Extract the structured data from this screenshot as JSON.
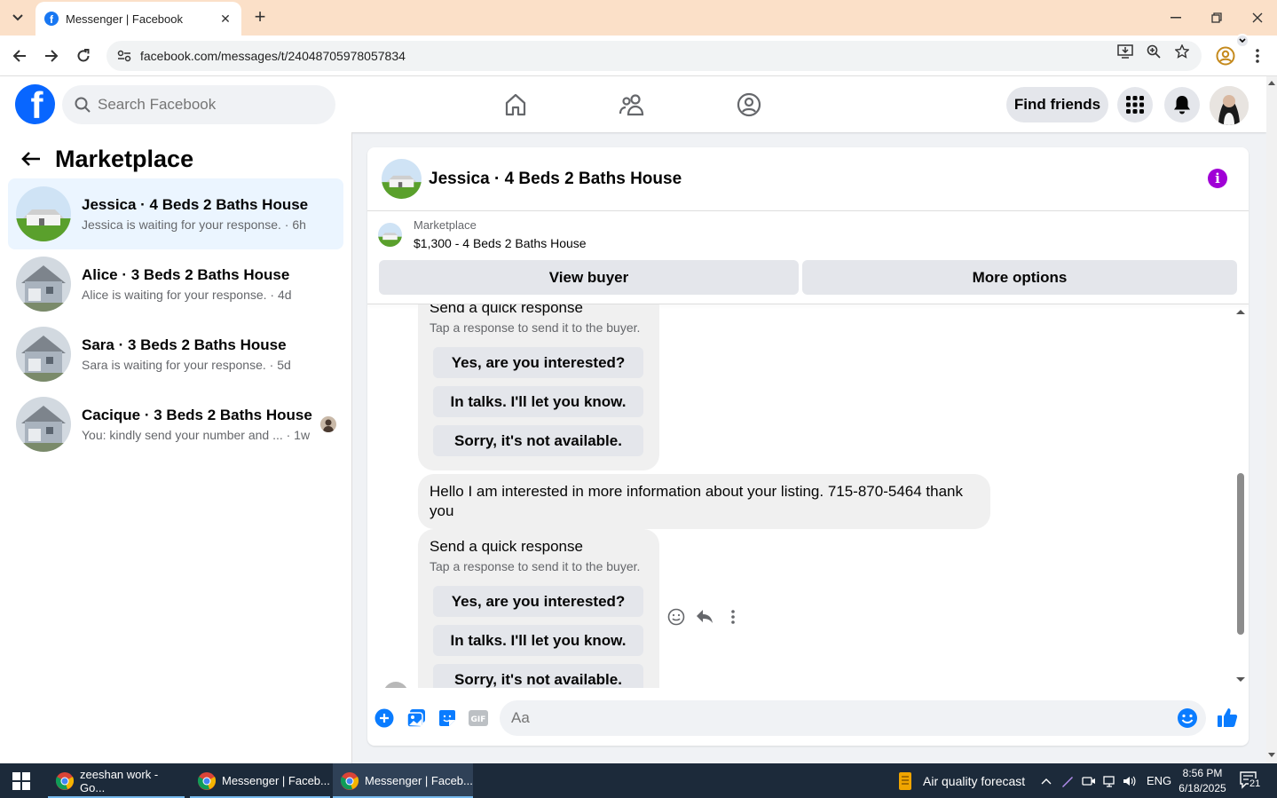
{
  "browser": {
    "tab_title": "Messenger | Facebook",
    "url": "facebook.com/messages/t/24048705978057834"
  },
  "header": {
    "search_placeholder": "Search Facebook",
    "find_friends_label": "Find friends"
  },
  "sidebar": {
    "title": "Marketplace",
    "conversations": [
      {
        "name": "Jessica · 4 Beds 2 Baths House",
        "preview": "Jessica is waiting for your response. · 6h",
        "active": true
      },
      {
        "name": "Alice · 3 Beds 2 Baths House",
        "preview": "Alice is waiting for your response. · 4d",
        "active": false
      },
      {
        "name": "Sara · 3 Beds 2 Baths House",
        "preview": "Sara is waiting for your response. · 5d",
        "active": false
      },
      {
        "name": "Cacique · 3 Beds 2 Baths House",
        "preview": "You: kindly send your number and ... · 1w",
        "active": false
      }
    ]
  },
  "chat": {
    "title": "Jessica · 4 Beds 2 Baths House",
    "listing_category": "Marketplace",
    "listing_title": "$1,300 - 4 Beds 2 Baths House",
    "view_buyer_label": "View buyer",
    "more_options_label": "More options",
    "quick_response_title": "Send a quick response",
    "quick_response_sub": "Tap a response to send it to the buyer.",
    "quick_responses": [
      "Yes, are you interested?",
      "In talks. I'll let you know.",
      "Sorry, it's not available."
    ],
    "message_text": "Hello I am interested in more information about your listing. 715-870-5464 thank you",
    "composer_placeholder": "Aa"
  },
  "taskbar": {
    "items": [
      "zeeshan work - Go...",
      "Messenger | Faceb...",
      "Messenger | Faceb..."
    ],
    "weather": "Air quality forecast",
    "language": "ENG",
    "time": "8:56 PM",
    "date": "6/18/2025",
    "notification_count": "21"
  },
  "colors": {
    "facebook_blue": "#0866ff",
    "messenger_blue": "#0a7cff",
    "info_purple": "#a000d6",
    "active_conversation": "#ebf5ff"
  }
}
